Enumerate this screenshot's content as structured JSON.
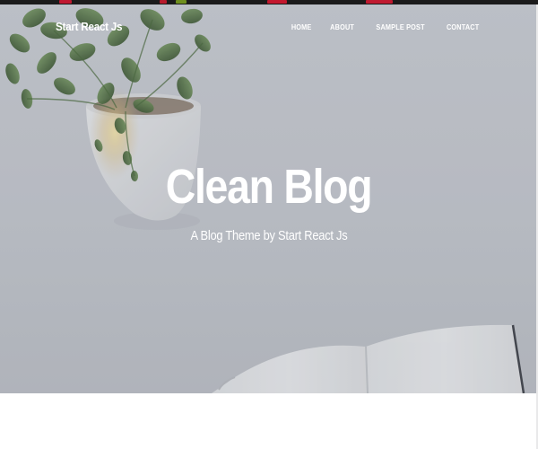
{
  "navbar": {
    "brand": "Start React Js",
    "links": [
      "HOME",
      "ABOUT",
      "SAMPLE POST",
      "CONTACT"
    ]
  },
  "hero": {
    "title": "Clean Blog",
    "subtitle": "A Blog Theme by Start React Js"
  },
  "colors": {
    "hero_background": "#c5c8cf",
    "text": "#ffffff",
    "page_background": "#ffffff",
    "top_strip": "#1b1b1b",
    "foliage": "#4d6b3f"
  },
  "icons": {
    "plant": "potted-plant-image",
    "notebook": "open-notebook-image"
  }
}
